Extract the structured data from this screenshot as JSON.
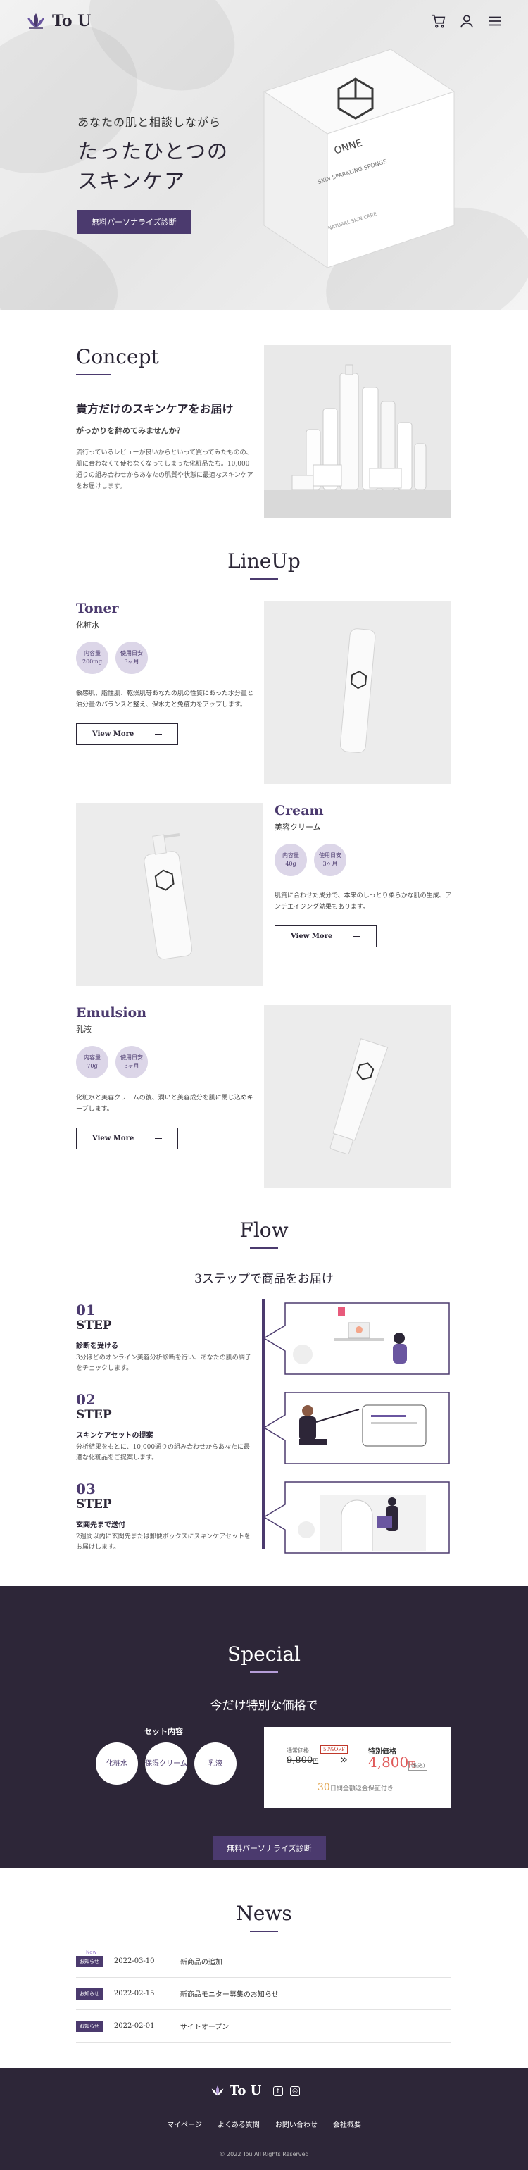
{
  "brand": {
    "name": "To U",
    "accent": "#4b3a6e",
    "dark": "#2d2638",
    "badge_bg": "#dcd6e8"
  },
  "header": {
    "icons": [
      "cart-icon",
      "user-icon",
      "menu-icon"
    ]
  },
  "hero": {
    "subtitle": "あなたの肌と相談しながら",
    "title_line1": "たったひとつの",
    "title_line2": "スキンケア",
    "cta": "無料パーソナライズ診断",
    "box_brand": "ONNE",
    "box_line1": "SKIN SPARKLING SPONGE",
    "box_line2": "NATURAL SKIN CARE"
  },
  "concept": {
    "title": "Concept",
    "heading": "貴方だけのスキンケアをお届け",
    "subheading": "がっかりを辞めてみませんか？",
    "body": "流行っているレビューが良いからといって買ってみたものの、肌に合わなくて使わなくなってしまった化粧品たち。10,000通りの組み合わせからあなたの肌質や状態に最適なスキンケアをお届けします。"
  },
  "lineup": {
    "title": "LineUp",
    "products": [
      {
        "name": "Toner",
        "jp": "化粧水",
        "badge1_label": "内容量",
        "badge1_value": "200mg",
        "badge2_label": "使用日安",
        "badge2_value": "3ヶ月",
        "desc": "敏感肌、脂性肌、乾燥肌等あなたの肌の性質にあった水分量と油分量のバランスと整え、保水力と免疫力をアップします。",
        "cta": "View More"
      },
      {
        "name": "Cream",
        "jp": "美容クリーム",
        "badge1_label": "内容量",
        "badge1_value": "40g",
        "badge2_label": "使用日安",
        "badge2_value": "3ヶ月",
        "desc": "肌質に合わせた成分で、本来のしっとり柔らかな肌の生成、アンチエイジング効果もあります。",
        "cta": "View More"
      },
      {
        "name": "Emulsion",
        "jp": "乳液",
        "badge1_label": "内容量",
        "badge1_value": "70g",
        "badge2_label": "使用日安",
        "badge2_value": "3ヶ月",
        "desc": "化粧水と美容クリームの後、潤いと美容成分を肌に閉じ込めキープします。",
        "cta": "View More"
      }
    ]
  },
  "flow": {
    "title": "Flow",
    "subtitle": "3ステップで商品をお届け",
    "steps": [
      {
        "num": "01",
        "word": "STEP",
        "heading": "診断を受ける",
        "body": "3分ほどのオンライン美容分析診断を行い、あなたの肌の調子をチェックします。"
      },
      {
        "num": "02",
        "word": "STEP",
        "heading": "スキンケアセットの提案",
        "body": "分析結果をもとに、10,000通りの組み合わせからあなたに最適な化粧品をご提案します。"
      },
      {
        "num": "03",
        "word": "STEP",
        "heading": "玄関先まで送付",
        "body": "2週間以内に玄関先または郵便ボックスにスキンケアセットをお届けします。"
      }
    ]
  },
  "special": {
    "title": "Special",
    "subtitle": "今だけ特別な価格で",
    "set_title": "セット内容",
    "set_items": [
      "化粧水",
      "保湿クリーム",
      "乳液"
    ],
    "regular_label": "通常価格",
    "regular_price": "9,800",
    "yen": "円",
    "off_tag": "50%OFF",
    "special_label": "特別価格",
    "special_price": "4,800",
    "tax": "(税込)",
    "guarantee_days": "30",
    "guarantee_text": "日間全額返金保証付き",
    "cta": "無料パーソナライズ診断"
  },
  "news": {
    "title": "News",
    "new_label": "New",
    "tag": "お知らせ",
    "items": [
      {
        "date": "2022-03-10",
        "text": "新商品の追加"
      },
      {
        "date": "2022-02-15",
        "text": "新商品モニター募集のお知らせ"
      },
      {
        "date": "2022-02-01",
        "text": "サイトオープン"
      }
    ]
  },
  "footer": {
    "brand": "To U",
    "nav": [
      "マイページ",
      "よくある質問",
      "お問い合わせ",
      "会社概要"
    ],
    "copyright": "© 2022 Tou All Rights Reserved"
  }
}
